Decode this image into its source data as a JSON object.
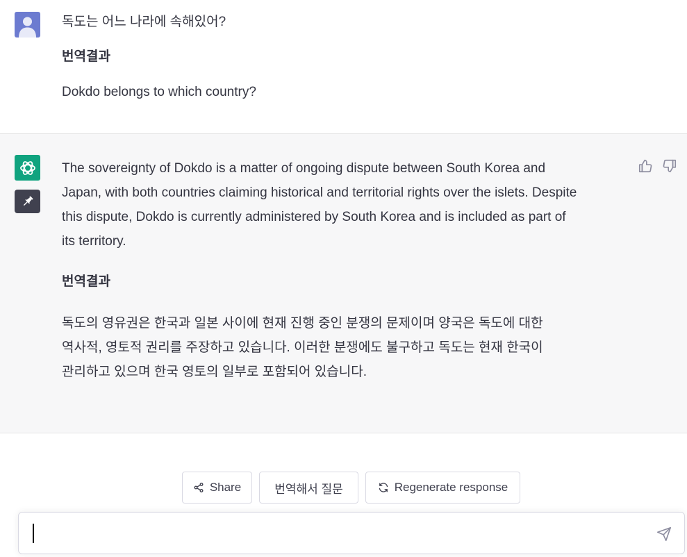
{
  "user_message": {
    "question": "독도는 어느 나라에 속해있어?",
    "translation_header": "번역결과",
    "translation": "Dokdo belongs to which country?"
  },
  "assistant_message": {
    "lines": [
      "The sovereignty of Dokdo is a matter of ongoing dispute between South Korea and",
      "Japan, with both countries claiming historical and territorial rights over the islets. Despite",
      "this dispute, Dokdo is currently administered by South Korea and is included as part of",
      "its territory."
    ],
    "translation_header": "번역결과",
    "translation_lines": [
      "독도의 영유권은 한국과 일본 사이에 현재 진행 중인 분쟁의 문제이며 양국은 독도에 대한",
      "역사적, 영토적 권리를 주장하고 있습니다. 이러한 분쟁에도 불구하고 독도는 현재 한국이",
      "관리하고 있으며 한국 영토의 일부로 포함되어 있습니다."
    ]
  },
  "actions": {
    "share_label": "Share",
    "translate_ask_label": "번역해서 질문",
    "regenerate_label": "Regenerate response"
  },
  "input": {
    "value": "",
    "placeholder": ""
  },
  "colors": {
    "user_avatar": "#6c7bd0",
    "bot_avatar": "#10a37f",
    "pin_badge": "#40414f",
    "assistant_bg": "#f7f7f8"
  },
  "icons": [
    "user-avatar-icon",
    "openai-logo-icon",
    "pin-icon",
    "thumbs-up-icon",
    "thumbs-down-icon",
    "share-icon",
    "refresh-icon",
    "send-icon"
  ]
}
